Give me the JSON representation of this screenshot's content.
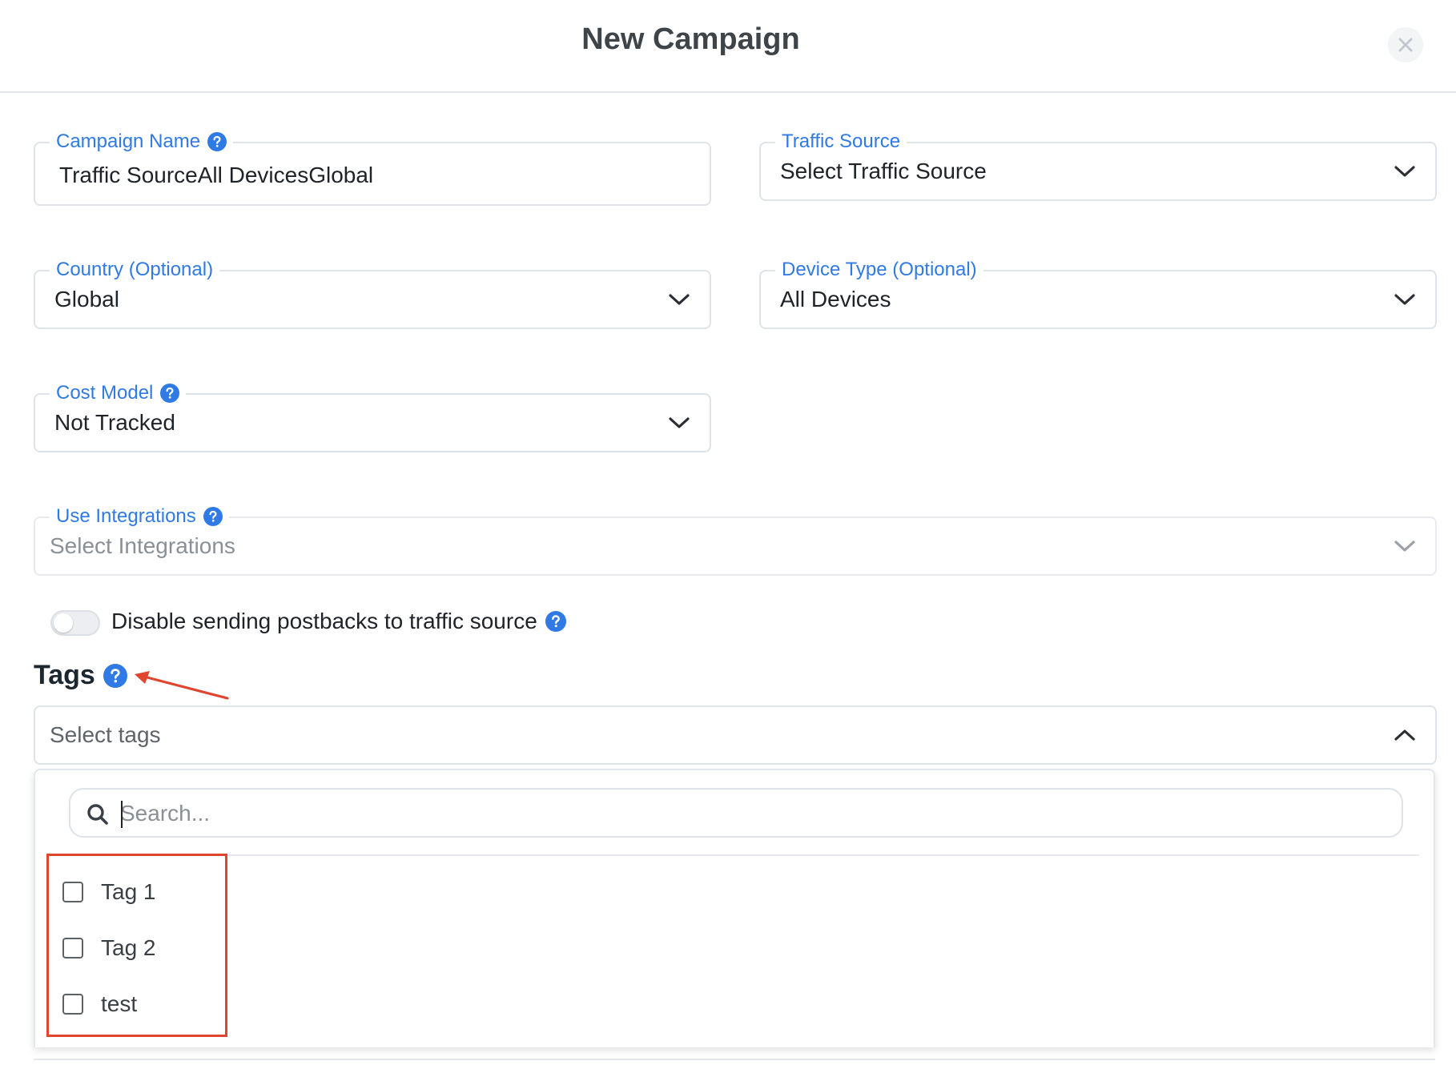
{
  "modal": {
    "title": "New Campaign",
    "close_icon": "close-icon"
  },
  "form": {
    "campaign_name": {
      "label": "Campaign Name",
      "value": "Traffic SourceAll DevicesGlobal",
      "has_help": true
    },
    "traffic_source": {
      "label": "Traffic Source",
      "value": "Select Traffic Source"
    },
    "country": {
      "label": "Country (Optional)",
      "value": "Global"
    },
    "device_type": {
      "label": "Device Type (Optional)",
      "value": "All Devices"
    },
    "cost_model": {
      "label": "Cost Model",
      "value": "Not Tracked",
      "has_help": true
    },
    "integrations": {
      "label": "Use Integrations",
      "placeholder": "Select Integrations",
      "has_help": true
    },
    "postbacks_toggle": {
      "label": "Disable sending postbacks to traffic source",
      "on": false
    }
  },
  "tags": {
    "heading": "Tags",
    "select_placeholder": "Select tags",
    "dropdown_open": true,
    "search_placeholder": "Search...",
    "options": [
      {
        "label": "Tag 1",
        "checked": false
      },
      {
        "label": "Tag 2",
        "checked": false
      },
      {
        "label": "test",
        "checked": false
      }
    ]
  },
  "colors": {
    "accent_blue": "#2f7ae5",
    "annotation_red": "#e0452f",
    "border": "#dfe3e8"
  }
}
